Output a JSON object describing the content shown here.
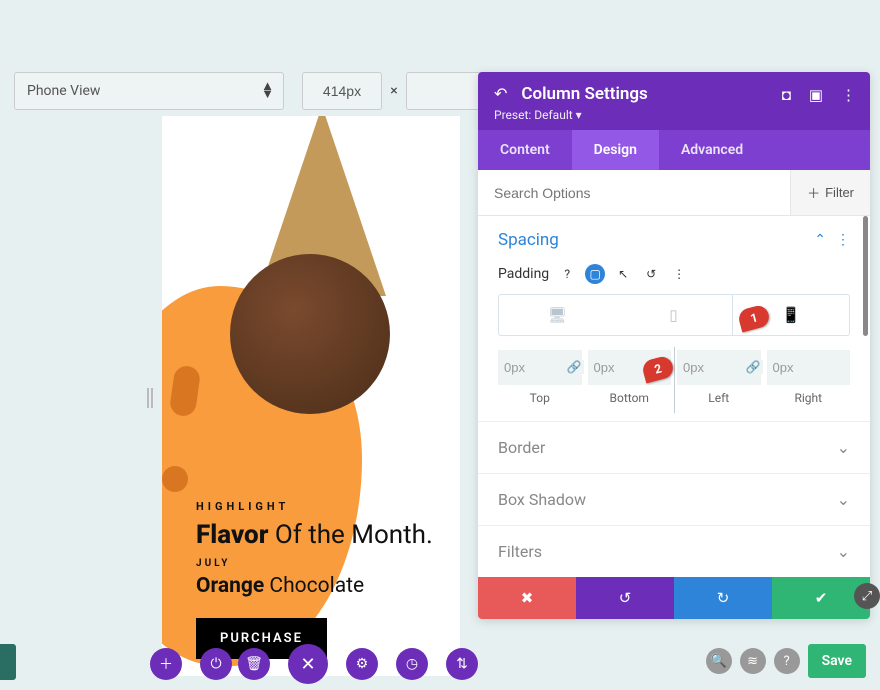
{
  "toolbar": {
    "view_mode": "Phone View",
    "width_value": "414px",
    "separator": "×"
  },
  "preview": {
    "eyebrow": "HIGHLIGHT",
    "headline_bold": "Flavor",
    "headline_rest": "Of the Month.",
    "subhead": "JULY",
    "flavor_bold": "Orange",
    "flavor_rest": "Chocolate",
    "cta": "PURCHASE"
  },
  "panel": {
    "title": "Column Settings",
    "preset_label": "Preset:",
    "preset_value": "Default",
    "tabs": {
      "content": "Content",
      "design": "Design",
      "advanced": "Advanced"
    },
    "search_placeholder": "Search Options",
    "filter_label": "Filter",
    "sections": {
      "spacing": "Spacing",
      "border": "Border",
      "box_shadow": "Box Shadow",
      "filters": "Filters"
    },
    "padding": {
      "label": "Padding",
      "top": {
        "value": "0px",
        "label": "Top"
      },
      "bottom": {
        "value": "0px",
        "label": "Bottom"
      },
      "left": {
        "value": "0px",
        "label": "Left"
      },
      "right": {
        "value": "0px",
        "label": "Right"
      }
    },
    "markers": {
      "one": "1",
      "two": "2"
    }
  },
  "footer": {
    "save": "Save"
  }
}
